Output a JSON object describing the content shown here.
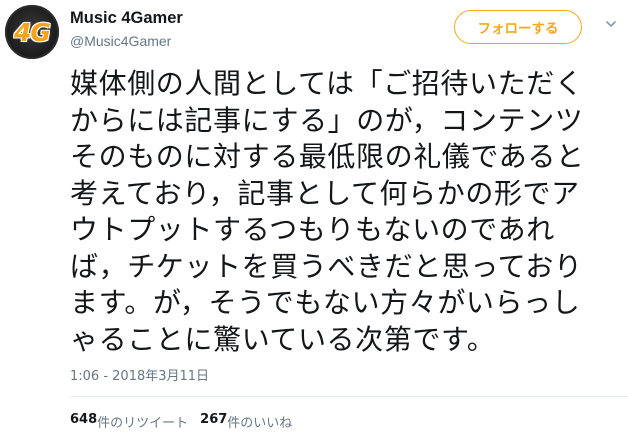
{
  "account": {
    "display_name": "Music 4Gamer",
    "handle": "@Music4Gamer",
    "avatar_text": "4G"
  },
  "follow_button": {
    "label": "フォローする"
  },
  "tweet": {
    "lines": [
      "媒体側の人間としては「ご招待いただく",
      "からには記事にする」のが，コンテンツ",
      "そのものに対する最低限の礼儀であると",
      "考えており，記事として何らかの形でア",
      "ウトプットするつもりもないのであれ",
      "ば，チケットを買うべきだと思っており",
      "ます。が，そうでもない方々がいらっし",
      "ゃることに驚いている次第です。"
    ],
    "timestamp": "1:06 - 2018年3月11日"
  },
  "stats": {
    "retweets_count": "648",
    "retweets_label": "件のリツイート",
    "likes_count": "267",
    "likes_label": "件のいいね"
  },
  "colors": {
    "accent": "#f5a623",
    "text": "#14171a",
    "secondary": "#657786",
    "divider": "#e6ecf0"
  },
  "icons": {
    "menu": "chevron-down-icon"
  }
}
